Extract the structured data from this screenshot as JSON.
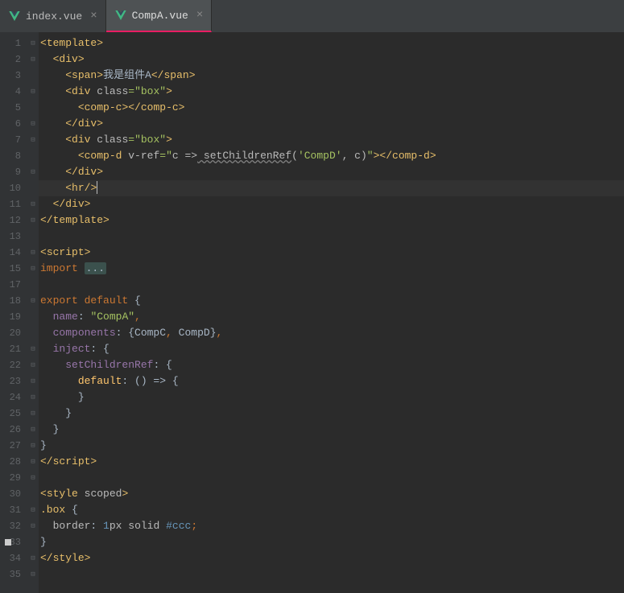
{
  "tabs": [
    {
      "label": "index.vue",
      "active": false
    },
    {
      "label": "CompA.vue",
      "active": true
    }
  ],
  "gutter_lines": [
    "1",
    "2",
    "3",
    "4",
    "5",
    "6",
    "7",
    "8",
    "9",
    "10",
    "11",
    "12",
    "13",
    "14",
    "15",
    "17",
    "18",
    "19",
    "20",
    "21",
    "22",
    "23",
    "24",
    "25",
    "26",
    "27",
    "28",
    "29",
    "30",
    "31",
    "32",
    "33",
    "34",
    "35"
  ],
  "fold_markers": {
    "0": "⊟",
    "1": "⊟",
    "3": "⊟",
    "5": "⊟",
    "6": "⊟",
    "8": "⊟",
    "10": "⊟",
    "11": "⊟",
    "13": "⊟",
    "14": "⊟",
    "16": "⊟",
    "19": "⊟",
    "20": "⊟",
    "21": "⊟",
    "22": "⊟",
    "23": "⊟",
    "24": "⊟",
    "25": "⊟",
    "26": "⊟",
    "27": "⊟",
    "29": "⊟",
    "30": "⊟",
    "32": "⊟",
    "33": "⊟"
  },
  "code": {
    "l1_tag": "template",
    "l2_tag": "div",
    "l3_tag": "span",
    "l3_txt": "我是组件A",
    "l4_tag": "div",
    "l4_attr": "class",
    "l4_val": "\"box\"",
    "l5_tag": "comp-c",
    "l6_tag": "div",
    "l7_tag": "div",
    "l7_attr": "class",
    "l7_val": "\"box\"",
    "l8_tag": "comp-d",
    "l8_attr": "v-ref",
    "l8_val1": "\"",
    "l8_valc": "c ",
    "l8_arrow": "=>",
    "l8_setref": " setChildrenRef",
    "l8_paren": "(",
    "l8_compd": "'CompD'",
    "l8_comma": ", ",
    "l8_c2": "c",
    "l8_close": ")",
    "l8_valend": "\"",
    "l9_tag": "div",
    "l10_tag": "hr",
    "l11_tag": "div",
    "l12_tag": "template",
    "l14_open": "<",
    "l14_tag": "script",
    "l14_close": ">",
    "l15_kw": "import",
    "l15_fold": "...",
    "l18_kw1": "export",
    "l18_kw2": "default",
    "l19_prop": "name",
    "l19_val": "\"CompA\"",
    "l20_prop": "components",
    "l20_v1": "CompC",
    "l20_v2": "CompD",
    "l21_prop": "inject",
    "l22_prop": "setChildrenRef",
    "l23_prop": "default",
    "l28_tag": "script",
    "l30_tag": "style",
    "l30_attr": "scoped",
    "l31_sel": ".box",
    "l32_prop": "border",
    "l32_v1": "1",
    "l32_v1b": "px",
    "l32_v2": "solid",
    "l32_v3": "#ccc",
    "l34_tag": "style"
  },
  "current_line_index": 9,
  "breakpoint_line_index": 31
}
